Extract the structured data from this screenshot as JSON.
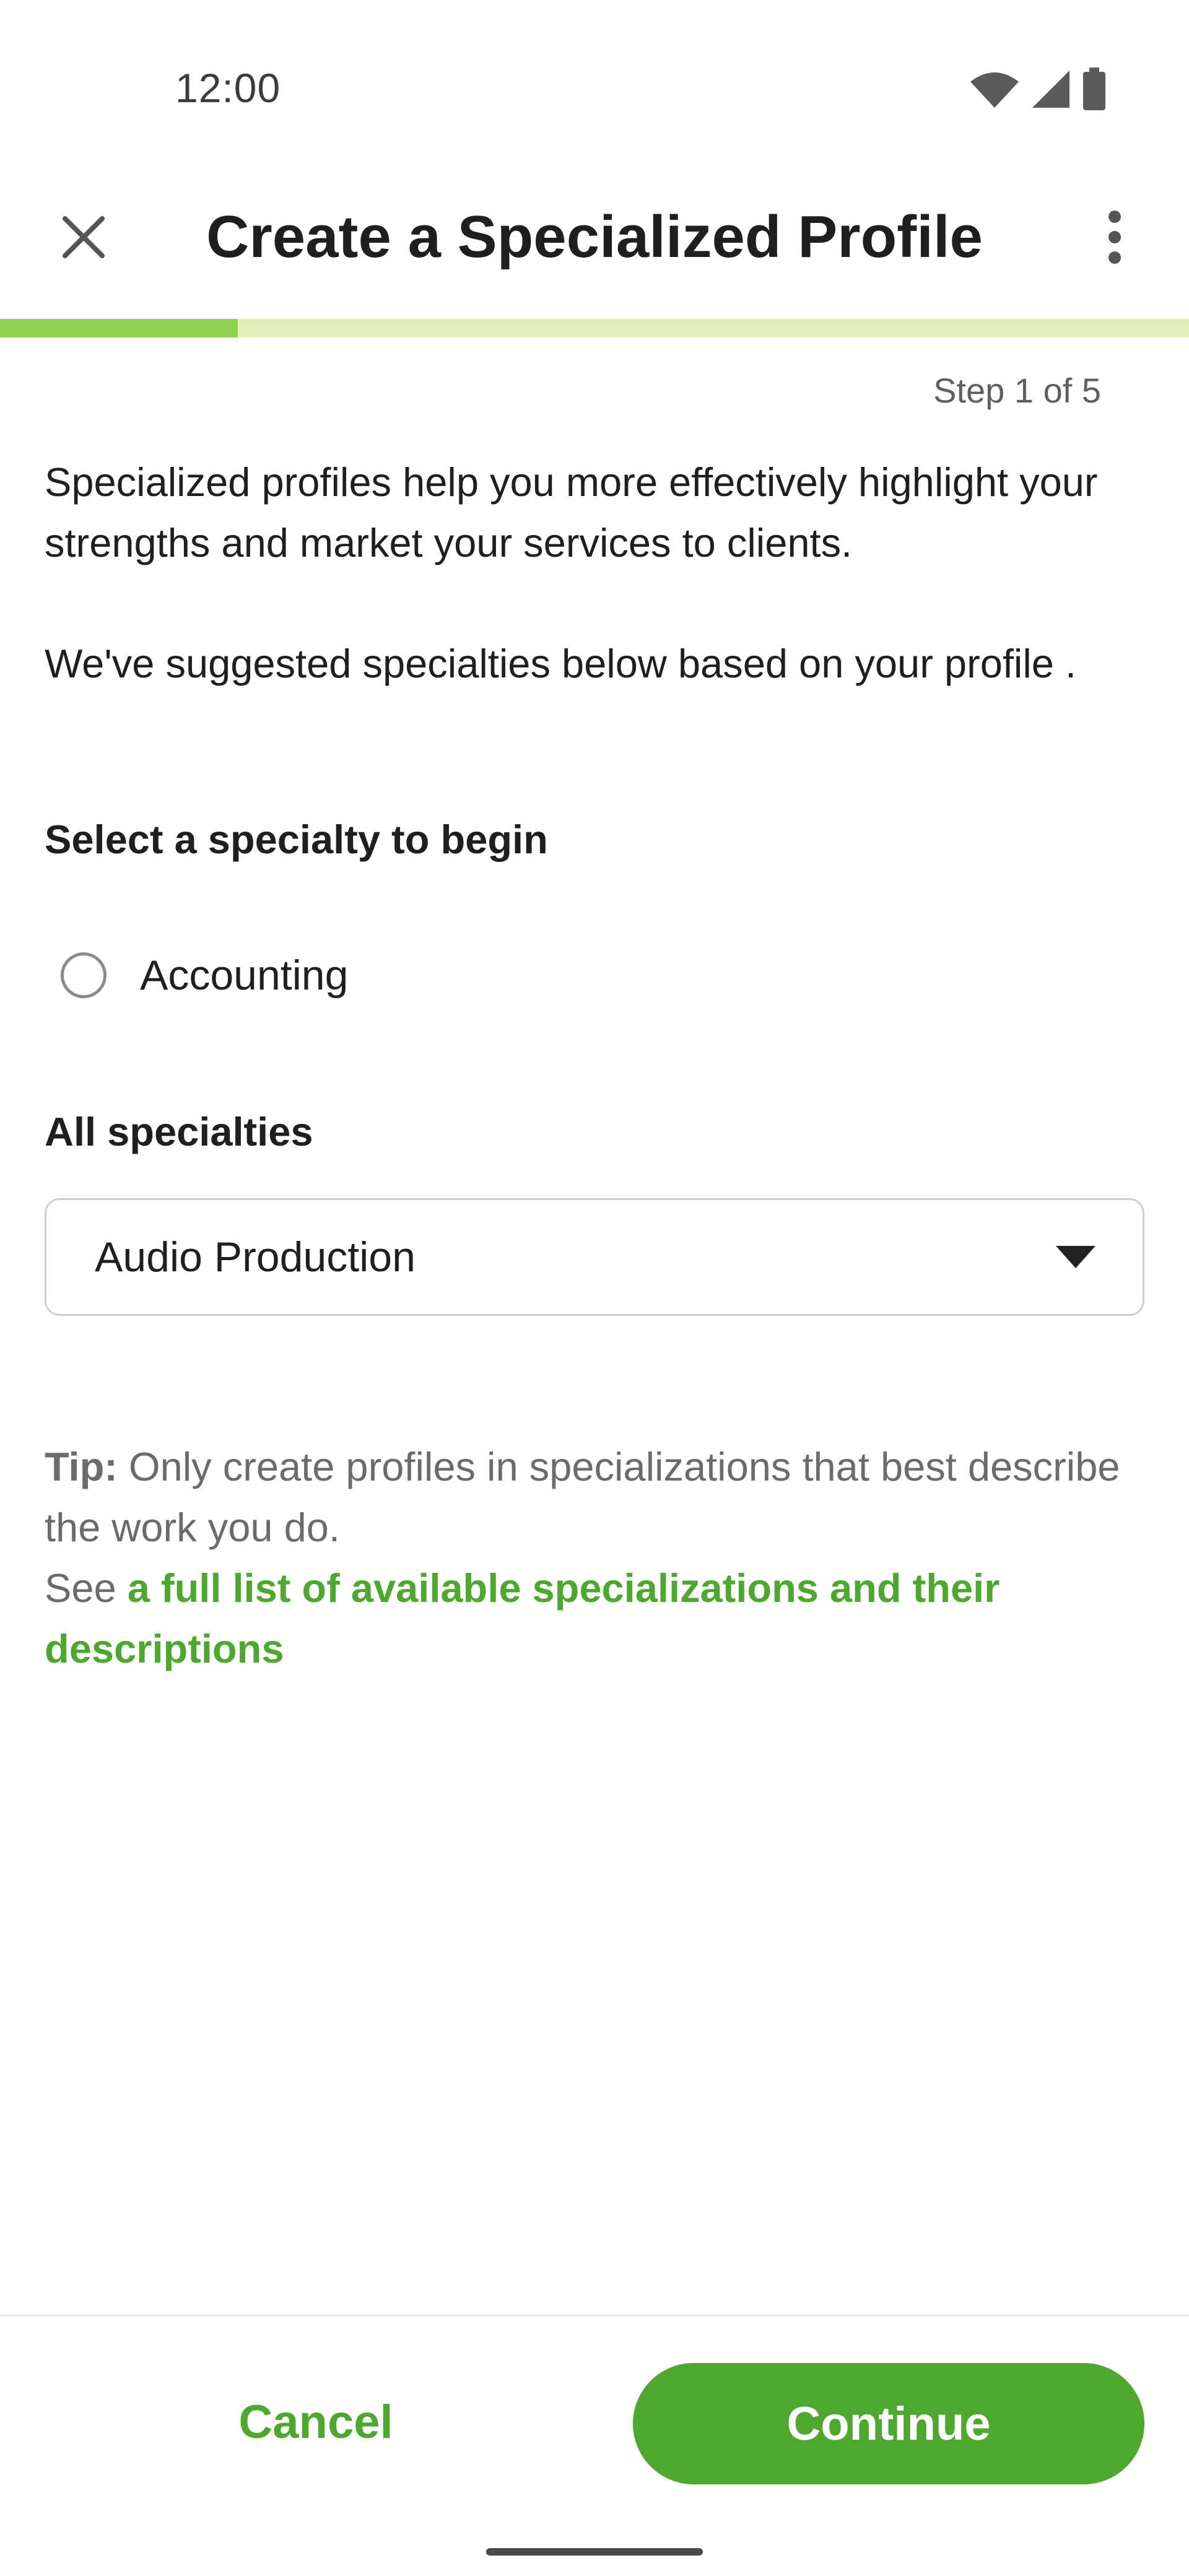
{
  "status_bar": {
    "time": "12:00",
    "icons": [
      "wifi-icon",
      "cellular-icon",
      "battery-icon"
    ]
  },
  "app_bar": {
    "title": "Create a Specialized Profile",
    "close_icon": "close-icon",
    "more_icon": "more-vert-icon"
  },
  "progress": {
    "current_step": 1,
    "total_steps": 5,
    "fraction": 0.2,
    "label": "Step 1 of 5"
  },
  "intro": {
    "paragraph_1": "Specialized profiles help you more effectively highlight your strengths and market your services to clients.",
    "paragraph_2": "We've suggested specialties below based on your profile ."
  },
  "suggested": {
    "heading": "Select a specialty to begin",
    "options": [
      {
        "label": "Accounting",
        "selected": false
      }
    ]
  },
  "all_specialties": {
    "heading": "All specialties",
    "selected_value": "Audio Production"
  },
  "tip": {
    "prefix": "Tip:",
    "text": " Only create profiles in specializations that best describe the work you do.",
    "see": "See ",
    "link": "a full list of available specializations and their descriptions"
  },
  "actions": {
    "cancel": "Cancel",
    "continue": "Continue"
  },
  "colors": {
    "accent": "#4ea82f",
    "progress_fill": "#8fd14f",
    "progress_track": "#dff0b8"
  }
}
